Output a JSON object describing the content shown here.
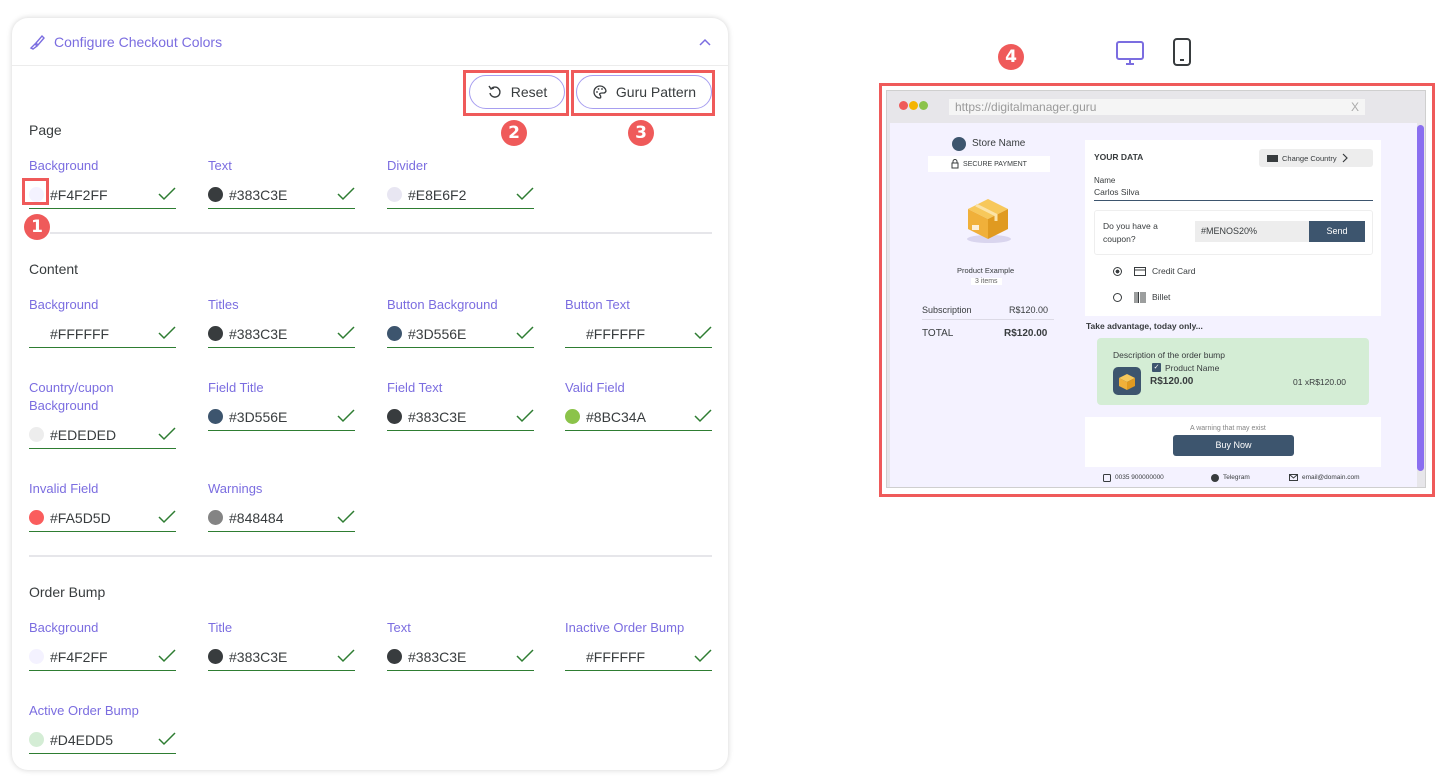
{
  "panel": {
    "title": "Configure Checkout Colors",
    "reset_label": "Reset",
    "guru_label": "Guru Pattern"
  },
  "annotations": [
    "1",
    "2",
    "3",
    "4"
  ],
  "page_section": {
    "title": "Page",
    "fields": [
      {
        "label": "Background",
        "value": "#F4F2FF",
        "color": "#F4F2FF"
      },
      {
        "label": "Text",
        "value": "#383C3E",
        "color": "#383C3E"
      },
      {
        "label": "Divider",
        "value": "#E8E6F2",
        "color": "#E8E6F2"
      }
    ]
  },
  "content_section": {
    "title": "Content",
    "fields": [
      {
        "label": "Background",
        "value": "#FFFFFF",
        "color": "#FFFFFF"
      },
      {
        "label": "Titles",
        "value": "#383C3E",
        "color": "#383C3E"
      },
      {
        "label": "Button Background",
        "value": "#3D556E",
        "color": "#3D556E"
      },
      {
        "label": "Button Text",
        "value": "#FFFFFF",
        "color": "#FFFFFF"
      },
      {
        "label": "Country/cupon Background",
        "value": "#EDEDED",
        "color": "#EDEDED"
      },
      {
        "label": "Field Title",
        "value": "#3D556E",
        "color": "#3D556E"
      },
      {
        "label": "Field Text",
        "value": "#383C3E",
        "color": "#383C3E"
      },
      {
        "label": "Valid Field",
        "value": "#8BC34A",
        "color": "#8BC34A"
      },
      {
        "label": "Invalid Field",
        "value": "#FA5D5D",
        "color": "#FA5D5D"
      },
      {
        "label": "Warnings",
        "value": "#848484",
        "color": "#848484"
      }
    ]
  },
  "order_bump_section": {
    "title": "Order Bump",
    "fields": [
      {
        "label": "Background",
        "value": "#F4F2FF",
        "color": "#F4F2FF"
      },
      {
        "label": "Title",
        "value": "#383C3E",
        "color": "#383C3E"
      },
      {
        "label": "Text",
        "value": "#383C3E",
        "color": "#383C3E"
      },
      {
        "label": "Inactive Order Bump",
        "value": "#FFFFFF",
        "color": "#FFFFFF"
      },
      {
        "label": "Active Order Bump",
        "value": "#D4EDD5",
        "color": "#D4EDD5"
      }
    ]
  },
  "preview": {
    "url": "https://digitalmanager.guru",
    "close": "X",
    "store_name": "Store Name",
    "secure_payment": "SECURE PAYMENT",
    "product_example": "Product Example",
    "items": "3 items",
    "subscription_label": "Subscription",
    "subscription_value": "R$120.00",
    "total_label": "TOTAL",
    "total_value": "R$120.00",
    "your_data": "YOUR DATA",
    "change_country": "Change Country",
    "name_label": "Name",
    "name_value": "Carlos Silva",
    "coupon_question": "Do you have a coupon?",
    "coupon_code": "#MENOS20%",
    "send": "Send",
    "credit_card": "Credit Card",
    "billet": "Billet",
    "take_advantage": "Take advantage, today only...",
    "bump_description": "Description of the order bump",
    "bump_product": "Product Name",
    "bump_price": "R$120.00",
    "bump_qty": "01 xR$120.00",
    "warning": "A warning that may exist",
    "buy_now": "Buy Now",
    "phone": "0035 900000000",
    "telegram": "Telegram",
    "email": "email@domain.com"
  }
}
